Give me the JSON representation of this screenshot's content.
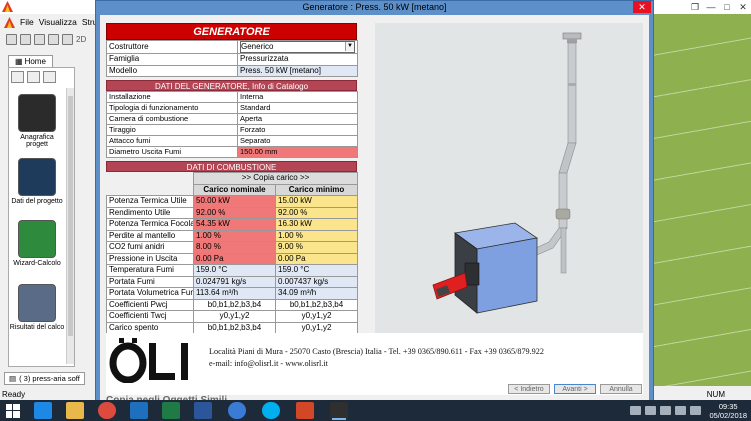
{
  "background_app": {
    "menu": [
      "File",
      "Visualizza",
      "Strumen"
    ],
    "toolbar_text": "2D",
    "tab_home": "Home",
    "nav_items": [
      {
        "label": "Anagrafica progett"
      },
      {
        "label": "Dati del progetto"
      },
      {
        "label": "Wizard-Calcolo"
      },
      {
        "label": "Risultati del calco"
      }
    ],
    "bottom_tab": "( 3) press-aria soff",
    "status_left": "Ready",
    "status_right": "NUM"
  },
  "dialog": {
    "title": "Generatore : Press. 50 kW [metano]",
    "close_label": "✕",
    "header_main": "GENERATORE",
    "top_rows": [
      {
        "label": "Costruttore",
        "value": "Generico",
        "dropdown": true
      },
      {
        "label": "Famiglia",
        "value": "Pressurizzata"
      },
      {
        "label": "Modello",
        "value": "Press. 50 kW [metano]"
      }
    ],
    "section_catalog": "DATI DEL GENERATORE, Info di Catalogo",
    "catalog_rows": [
      {
        "label": "Installazione",
        "value": "Interna"
      },
      {
        "label": "Tipologia di funzionamento",
        "value": "Standard"
      },
      {
        "label": "Camera di combustione",
        "value": "Aperta"
      },
      {
        "label": "Tiraggio",
        "value": "Forzato"
      },
      {
        "label": "Attacco fumi",
        "value": "Separato"
      },
      {
        "label": "Diametro Uscita Fumi",
        "value": "150.00 mm"
      }
    ],
    "section_combustion": "DATI DI COMBUSTIONE",
    "copy_button": ">> Copia carico >>",
    "col_nominal": "Carico nominale",
    "col_min": "Carico minimo",
    "combustion_rows": [
      {
        "label": "Potenza Termica Utile",
        "nominal": "50.00 kW",
        "min": "15.00 kW",
        "style": "ry"
      },
      {
        "label": "Rendimento Utile",
        "nominal": "92.00 %",
        "min": "92.00 %",
        "style": "ry"
      },
      {
        "label": "Potenza Termica Focolare",
        "nominal": "54.35 kW",
        "min": "16.30 kW",
        "style": "ry"
      },
      {
        "label": "Perdite al mantello",
        "nominal": "1.00 %",
        "min": "1.00 %",
        "style": "ry"
      },
      {
        "label": "CO2 fumi anidri",
        "nominal": "8.00 %",
        "min": "9.00 %",
        "style": "ry"
      },
      {
        "label": "Pressione in Uscita",
        "nominal": "0.00 Pa",
        "min": "0.00 Pa",
        "style": "ry"
      },
      {
        "label": "Temperatura Fumi",
        "nominal": "159.0 °C",
        "min": "159.0 °C",
        "style": "bb"
      },
      {
        "label": "Portata Fumi",
        "nominal": "0.024791 kg/s",
        "min": "0.007437 kg/s",
        "style": "bb"
      },
      {
        "label": "Portata Volumetrica Fumi",
        "nominal": "113.64 m³/h",
        "min": "34.09 m³/h",
        "style": "bb"
      },
      {
        "label": "Coefficienti Pwcj",
        "nominal": "b0,b1,b2,b3,b4",
        "min": "b0,b1,b2,b3,b4",
        "style": "cc"
      },
      {
        "label": "Coefficienti Twcj",
        "nominal": "y0,y1,y2",
        "min": "y0,y1,y2",
        "style": "cc"
      },
      {
        "label": "Carico spento",
        "nominal": "b0,b1,b2,b3,b4",
        "min": "y0,y1,y2",
        "style": "cc"
      }
    ],
    "footer": {
      "logo_text": "ÖLI",
      "address": "Località Piani di Mura - 25070 Casto (Brescia) Italia - Tel. +39 0365/890.611 - Fax +39 0365/879.922",
      "contact": "e-mail: info@olisrl.it - www.olisrl.it",
      "link": "Copia negli Oggetti Simili"
    },
    "nav_buttons": {
      "back": "< Indietro",
      "next": "Avanti >",
      "cancel": "Annulla"
    }
  },
  "taskbar": {
    "time": "09:35",
    "date": "05/02/2018"
  },
  "colors": {
    "header_red": "#cc0000",
    "section_rose": "#b34555",
    "value_red": "#f07878",
    "value_yellow": "#fbe58c",
    "value_blue": "#dfe8f4",
    "boiler_blue": "#7fa0e0",
    "burner_red": "#e02020"
  }
}
